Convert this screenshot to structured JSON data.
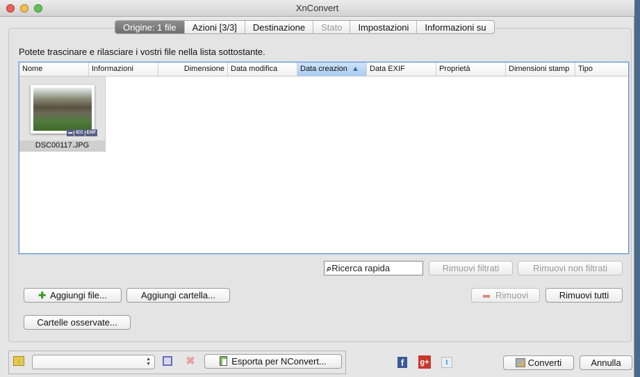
{
  "window": {
    "title": "XnConvert"
  },
  "tabs": [
    {
      "label": "Origine: 1 file",
      "state": "active"
    },
    {
      "label": "Azioni [3/3]",
      "state": "normal"
    },
    {
      "label": "Destinazione",
      "state": "normal"
    },
    {
      "label": "Stato",
      "state": "disabled"
    },
    {
      "label": "Impostazioni",
      "state": "normal"
    },
    {
      "label": "Informazioni su",
      "state": "normal"
    }
  ],
  "hint": "Potete trascinare e rilasciare i vostri file nella lista sottostante.",
  "columns": [
    "Nome",
    "Informazioni",
    "Dimensione",
    "Data modifica",
    "Data creazion",
    "Data EXIF",
    "Proprietà",
    "Dimensioni stamp",
    "Tipo"
  ],
  "sorted_column": "Data creazion",
  "sort_indicator": "▲",
  "files": [
    {
      "name": "DSC00117.JPG",
      "badges": [
        "▬",
        "ICC",
        "EXIF"
      ]
    }
  ],
  "search": {
    "placeholder": "Ricerca rapida"
  },
  "buttons": {
    "remove_filtered": "Rimuovi filtrati",
    "remove_unfiltered": "Rimuovi non filtrati",
    "add_files": "Aggiungi file...",
    "add_folder": "Aggiungi cartella...",
    "remove": "Rimuovi",
    "remove_all": "Rimuovi tutti",
    "watched_folders": "Cartelle osservate...",
    "export_nconvert": "Esporta per NConvert...",
    "convert": "Converti",
    "cancel": "Annulla"
  },
  "preset_select": {
    "value": ""
  },
  "social": {
    "facebook": "f",
    "google_plus": "g+",
    "twitter": "t"
  },
  "colors": {
    "active_tab": "#7a7a7a",
    "selection": "#a9ccf2",
    "add_icon": "#3a9a2a",
    "remove_icon": "#d98a7a"
  }
}
